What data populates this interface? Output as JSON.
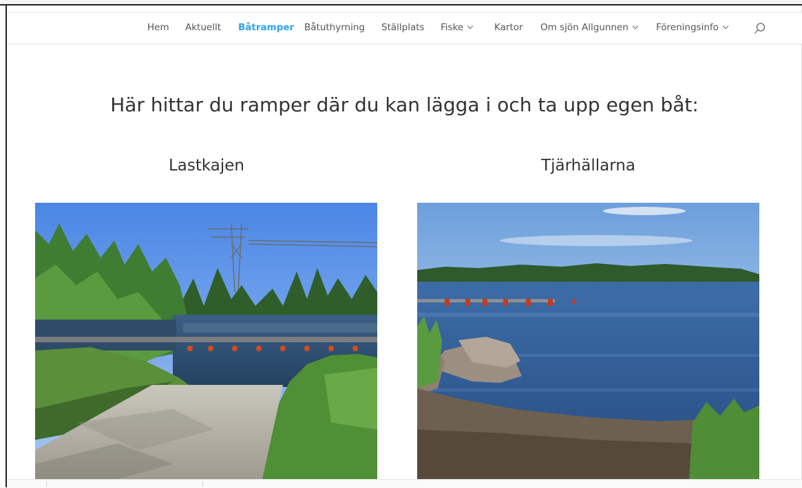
{
  "nav": {
    "items": [
      {
        "label": "Hem",
        "active": false,
        "dropdown": false
      },
      {
        "label": "Aktuellt",
        "active": false,
        "dropdown": false
      },
      {
        "label": "Båtramper",
        "active": true,
        "dropdown": false
      },
      {
        "label": "Båtuthyrning",
        "active": false,
        "dropdown": false
      },
      {
        "label": "Ställplats",
        "active": false,
        "dropdown": false
      },
      {
        "label": "Fiske",
        "active": false,
        "dropdown": true
      },
      {
        "label": "Kartor",
        "active": false,
        "dropdown": false
      },
      {
        "label": "Om sjön Allgunnen",
        "active": false,
        "dropdown": true
      },
      {
        "label": "Föreningsinfo",
        "active": false,
        "dropdown": true
      }
    ],
    "search_icon": "search-icon",
    "active_color": "#2ea3f2"
  },
  "main": {
    "headline": "Här hittar du ramper där du kan lägga i och ta upp egen båt:",
    "columns": [
      {
        "title": "Lastkajen",
        "image": "photo-lake-boat-ramp-with-pier"
      },
      {
        "title": "Tjärhällarna",
        "image": "photo-lake-shore-with-rocks-and-pier"
      }
    ]
  }
}
